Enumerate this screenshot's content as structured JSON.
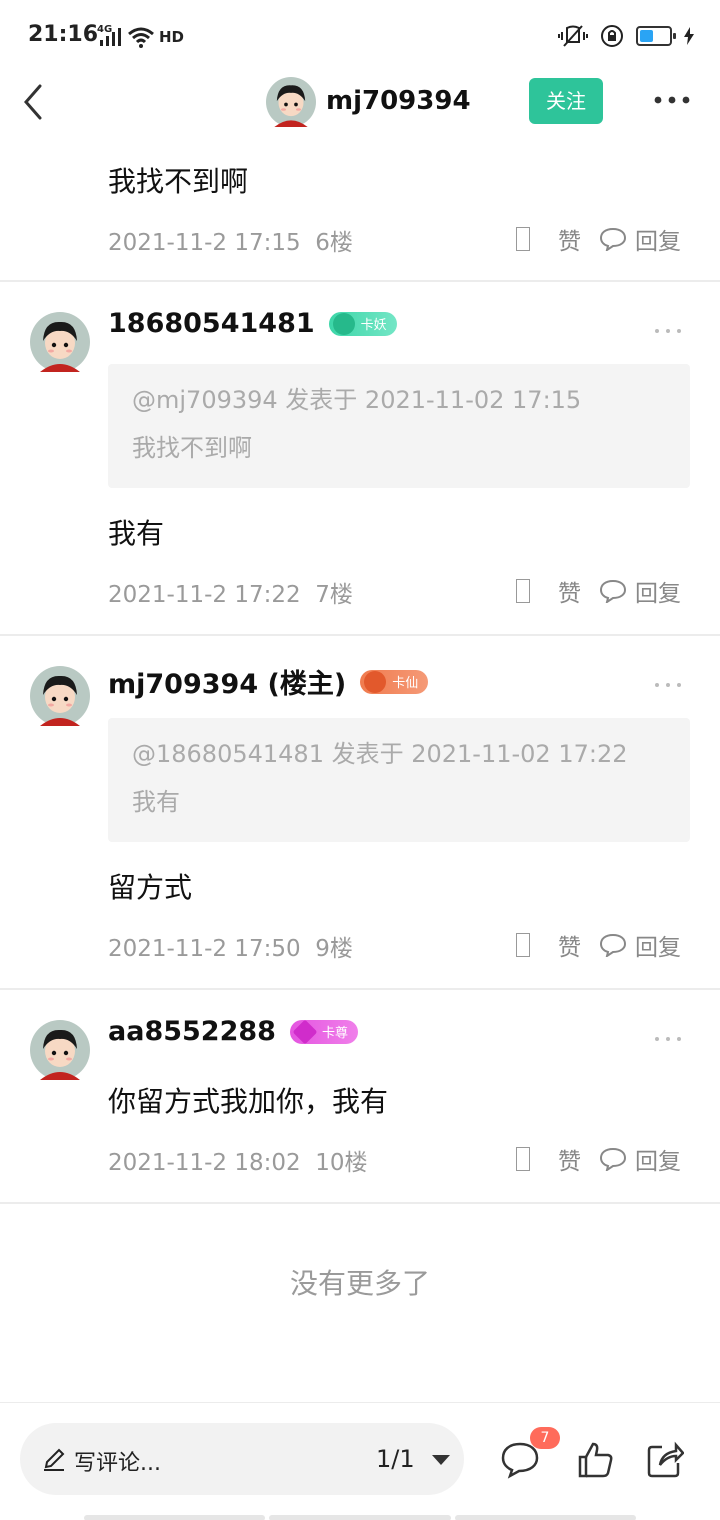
{
  "status_bar": {
    "time": "21:16",
    "network": "4G",
    "hd": "HD",
    "battery_level": 0.4,
    "accent": "#2aa4f4"
  },
  "header": {
    "username": "mj709394",
    "follow_label": "关注",
    "follow_color": "#2ec49a"
  },
  "top_partial": {
    "text": "我找不到啊",
    "timestamp": "2021-11-2 17:15",
    "floor": "6楼"
  },
  "actions": {
    "glyph": "〼",
    "like_label": "赞",
    "reply_label": "回复"
  },
  "posts": [
    {
      "username": "18680541481",
      "badge_label": "卡妖",
      "badge_icon": "star-icon",
      "badge_color": "#3cd6a8",
      "quote_header": "@mj709394 发表于 2021-11-02 17:15",
      "quote_text": "我找不到啊",
      "text": "我有",
      "timestamp": "2021-11-2 17:22",
      "floor": "7楼"
    },
    {
      "username": "mj709394 (楼主)",
      "badge_label": "卡仙",
      "badge_icon": "crown-icon",
      "badge_color": "#f07b4e",
      "quote_header": "@18680541481 发表于 2021-11-02 17:22",
      "quote_text": "我有",
      "text": "留方式",
      "timestamp": "2021-11-2 17:50",
      "floor": "9楼"
    },
    {
      "username": "aa8552288",
      "badge_label": "卡尊",
      "badge_icon": "diamond-icon",
      "badge_color": "#e455e0",
      "text": "你留方式我加你，我有",
      "timestamp": "2021-11-2 18:02",
      "floor": "10楼"
    }
  ],
  "end_text": "没有更多了",
  "bottom_bar": {
    "comment_placeholder": "写评论...",
    "page": "1/1",
    "comment_count": "7",
    "badge_color": "#ff6b5b"
  }
}
